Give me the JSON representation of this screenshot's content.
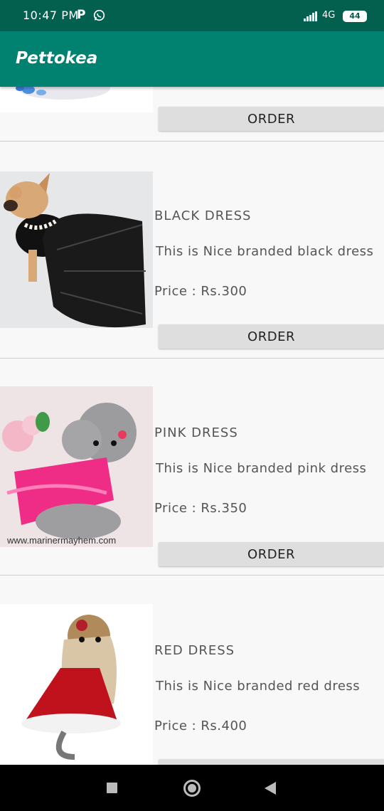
{
  "status_bar": {
    "time": "10:47 PM",
    "p_icon": "P",
    "network": "4G",
    "battery": "44"
  },
  "app_bar": {
    "title": "Pettokea"
  },
  "order_label": "ORDER",
  "products": [
    {
      "name": "BLACK DRESS",
      "description": "This is Nice branded black dress",
      "price": "Price  :  Rs.300"
    },
    {
      "name": "PINK DRESS",
      "description": "This is Nice branded pink dress",
      "price": "Price  :  Rs.350"
    },
    {
      "name": "RED DRESS",
      "description": "This is Nice branded  red dress",
      "price": "Price  :  Rs.400"
    }
  ],
  "image_watermark": "www.marinermayhem.com",
  "colors": {
    "status_bar": "#03604f",
    "app_bar": "#018271",
    "button": "#dedede"
  },
  "icons": {
    "whatsapp": "whatsapp-icon",
    "signal": "signal-icon",
    "battery": "battery-icon",
    "recents": "recents-icon",
    "home": "home-icon",
    "back": "back-icon"
  }
}
